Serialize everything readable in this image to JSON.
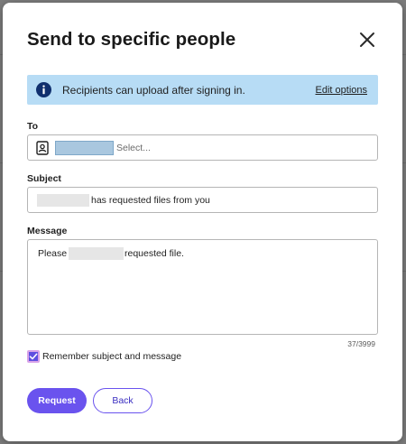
{
  "dialog": {
    "title": "Send to specific people",
    "close_icon": "close-icon"
  },
  "banner": {
    "icon": "info-icon",
    "message": "Recipients can upload after signing in.",
    "edit_link": "Edit options",
    "color": "#b7dcf5"
  },
  "to": {
    "label": "To",
    "icon": "contact-card-icon",
    "placeholder": "Select..."
  },
  "subject": {
    "label": "Subject",
    "text": "has requested files from you"
  },
  "message": {
    "label": "Message",
    "text_before": "Please",
    "text_after": "requested file.",
    "counter": "37/3999"
  },
  "remember": {
    "label": "Remember subject and message",
    "checked": true
  },
  "buttons": {
    "request": "Request",
    "back": "Back"
  },
  "colors": {
    "accent": "#6a53ee"
  }
}
